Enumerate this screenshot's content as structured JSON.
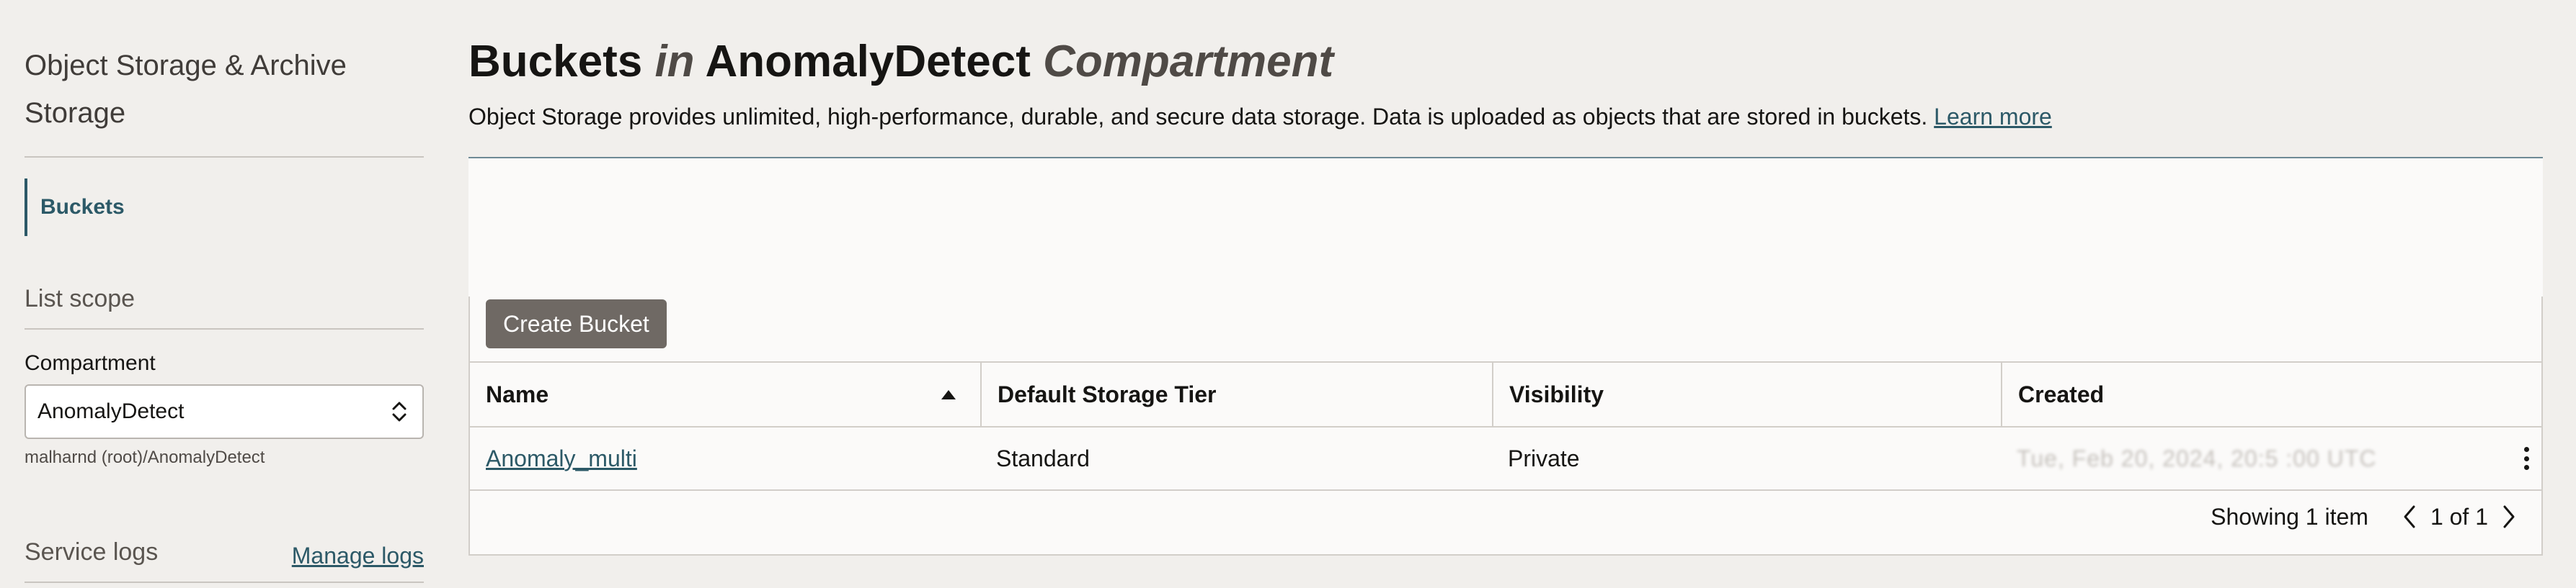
{
  "sidebar": {
    "title": "Object Storage & Archive Storage",
    "active_item": "Buckets",
    "list_scope_heading": "List scope",
    "compartment_label": "Compartment",
    "compartment_value": "AnomalyDetect",
    "compartment_path": "malharnd (root)/AnomalyDetect",
    "service_logs_heading": "Service logs",
    "manage_logs_link": "Manage logs"
  },
  "header": {
    "title_part1": "Buckets",
    "title_in": "in",
    "title_compartment": "AnomalyDetect",
    "title_suffix": "Compartment",
    "description": "Object Storage provides unlimited, high-performance, durable, and secure data storage. Data is uploaded as objects that are stored in buckets.",
    "learn_more": "Learn more"
  },
  "toolbar": {
    "create_bucket_label": "Create Bucket"
  },
  "table": {
    "columns": [
      "Name",
      "Default Storage Tier",
      "Visibility",
      "Created"
    ],
    "sort_column": "Name",
    "sort_direction": "ascending",
    "rows": [
      {
        "name": "Anomaly_multi",
        "storage_tier": "Standard",
        "visibility": "Private",
        "created": "Tue, Feb 20, 2024, 20:5 :00 UTC"
      }
    ]
  },
  "pagination": {
    "showing": "Showing 1 item",
    "page": "1 of 1"
  },
  "colors": {
    "accent": "#2c5967",
    "button_bg": "#6f6964",
    "page_bg": "#f1efec"
  },
  "icons": [
    "chevron-up-down-icon",
    "sort-ascending-icon",
    "kebab-menu-icon",
    "chevron-left-icon",
    "chevron-right-icon"
  ]
}
